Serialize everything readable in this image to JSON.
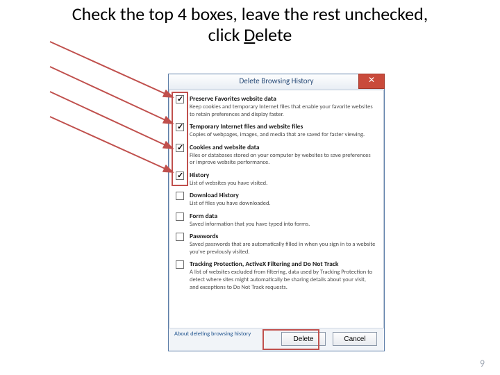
{
  "slide": {
    "title_line1": "Check the top 4 boxes, leave the rest unchecked,",
    "title_line2_prefix": "click ",
    "title_line2_underlined": "D",
    "title_line2_suffix": "elete",
    "page_number": "9"
  },
  "dialog": {
    "title": "Delete Browsing History",
    "close_glyph": "✕",
    "about_link": "About deleting browsing history",
    "delete_label": "Delete",
    "cancel_label": "Cancel"
  },
  "options": [
    {
      "checked": true,
      "label": "Preserve Favorites website data",
      "desc": "Keep cookies and temporary Internet files that enable your favorite websites to retain preferences and display faster."
    },
    {
      "checked": true,
      "label": "Temporary Internet files and website files",
      "desc": "Copies of webpages, images, and media that are saved for faster viewing."
    },
    {
      "checked": true,
      "label": "Cookies and website data",
      "desc": "Files or databases stored on your computer by websites to save preferences or improve website performance."
    },
    {
      "checked": true,
      "label": "History",
      "desc": "List of websites you have visited."
    },
    {
      "checked": false,
      "label": "Download History",
      "desc": "List of files you have downloaded."
    },
    {
      "checked": false,
      "label": "Form data",
      "desc": "Saved information that you have typed into forms."
    },
    {
      "checked": false,
      "label": "Passwords",
      "desc": "Saved passwords that are automatically filled in when you sign in to a website you've previously visited."
    },
    {
      "checked": false,
      "label": "Tracking Protection, ActiveX Filtering and Do Not Track",
      "desc": "A list of websites excluded from filtering, data used by Tracking Protection to detect where sites might automatically be sharing details about your visit, and exceptions to Do Not Track requests."
    }
  ],
  "callouts": {
    "arrow_color": "#c0504d"
  }
}
